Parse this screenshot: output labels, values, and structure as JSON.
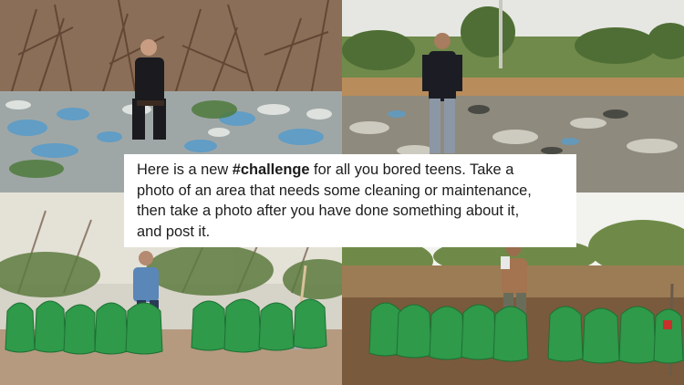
{
  "caption": {
    "line1_pre": "Here is a new ",
    "hashtag": "#challenge",
    "line1_post": " for all you bored teens. Take a",
    "line2": "photo of an area that needs some cleaning or maintenance,",
    "line3": "then take a photo after you have done something about it,",
    "line4": "and post it."
  },
  "photos": [
    {
      "position": "top-left",
      "subject": "man seated among trash-covered ground before cleanup"
    },
    {
      "position": "top-right",
      "subject": "man standing on littered field before cleanup"
    },
    {
      "position": "bottom-left",
      "subject": "man with row of filled green trash bags after cleanup"
    },
    {
      "position": "bottom-right",
      "subject": "man with row of filled green trash bags after cleanup"
    }
  ],
  "colors": {
    "trash_bag_green": "#2e9a4a",
    "plastic_blue": "#5b9cc9",
    "soil_brown": "#7a5a3c",
    "caption_bg": "#ffffff"
  }
}
